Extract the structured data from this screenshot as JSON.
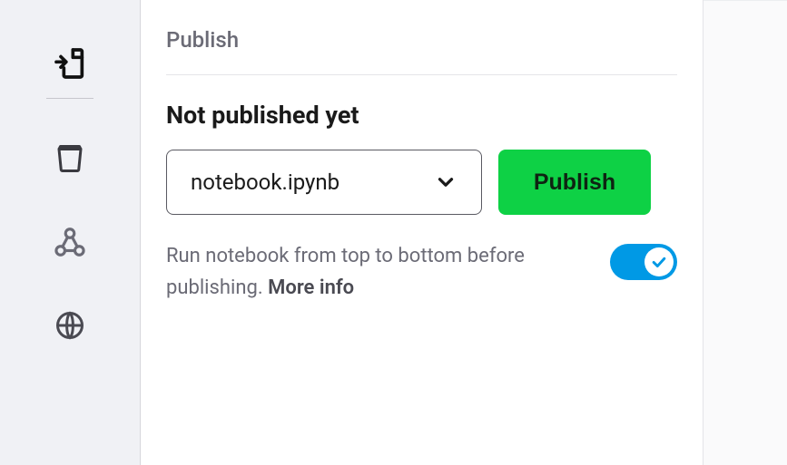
{
  "panel": {
    "title": "Publish",
    "status": "Not published yet",
    "file_selected": "notebook.ipynb",
    "publish_button": "Publish",
    "helper_text": "Run notebook from top to bottom before publishing.",
    "more_info_label": "More info",
    "run_toggle_on": true
  },
  "sidebar": {
    "icons": [
      "import-file",
      "jar",
      "nodes",
      "globe"
    ]
  },
  "colors": {
    "accent": "#0ed145",
    "toggle": "#0099e5"
  }
}
